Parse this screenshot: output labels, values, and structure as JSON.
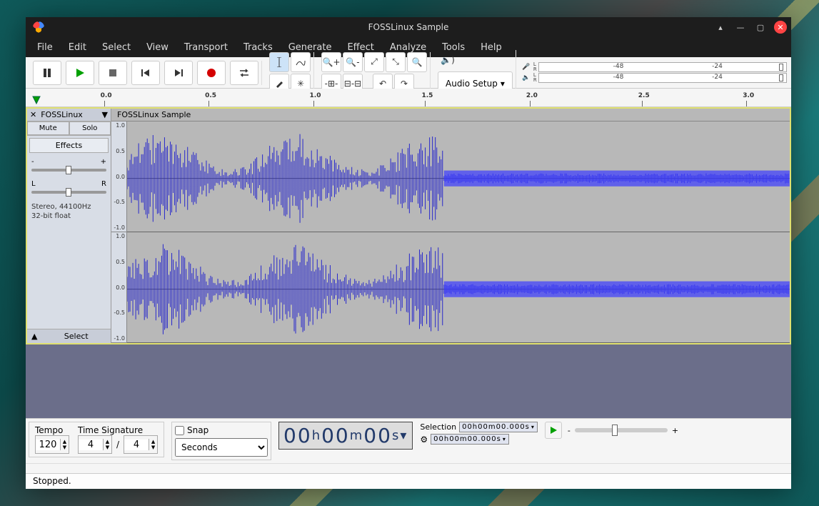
{
  "window": {
    "title": "FOSSLinux Sample"
  },
  "menu": [
    "File",
    "Edit",
    "Select",
    "View",
    "Transport",
    "Tracks",
    "Generate",
    "Effect",
    "Analyze",
    "Tools",
    "Help"
  ],
  "toolbar": {
    "audio_setup": "Audio Setup",
    "meter_ticks": [
      "-48",
      "-24"
    ]
  },
  "timeline": {
    "ticks": [
      "0.0",
      "0.5",
      "1.0",
      "1.5",
      "2.0",
      "2.5",
      "3.0"
    ]
  },
  "track": {
    "name": "FOSSLinux",
    "clip_title": "FOSSLinux Sample",
    "mute": "Mute",
    "solo": "Solo",
    "effects": "Effects",
    "pan_l": "L",
    "pan_r": "R",
    "info1": "Stereo, 44100Hz",
    "info2": "32-bit float",
    "select": "Select",
    "scale": [
      "1.0",
      "0.5",
      "0.0",
      "-0.5",
      "-1.0"
    ]
  },
  "bottom": {
    "tempo_label": "Tempo",
    "timesig_label": "Time Signature",
    "tempo": "120",
    "ts_num": "4",
    "ts_den": "4",
    "snap": "Snap",
    "snap_unit": "Seconds",
    "timecode": "00h00m00s",
    "selection_label": "Selection",
    "sel_tc1": "00h00m00.000s",
    "sel_tc2": "00h00m00.000s"
  },
  "status": "Stopped."
}
